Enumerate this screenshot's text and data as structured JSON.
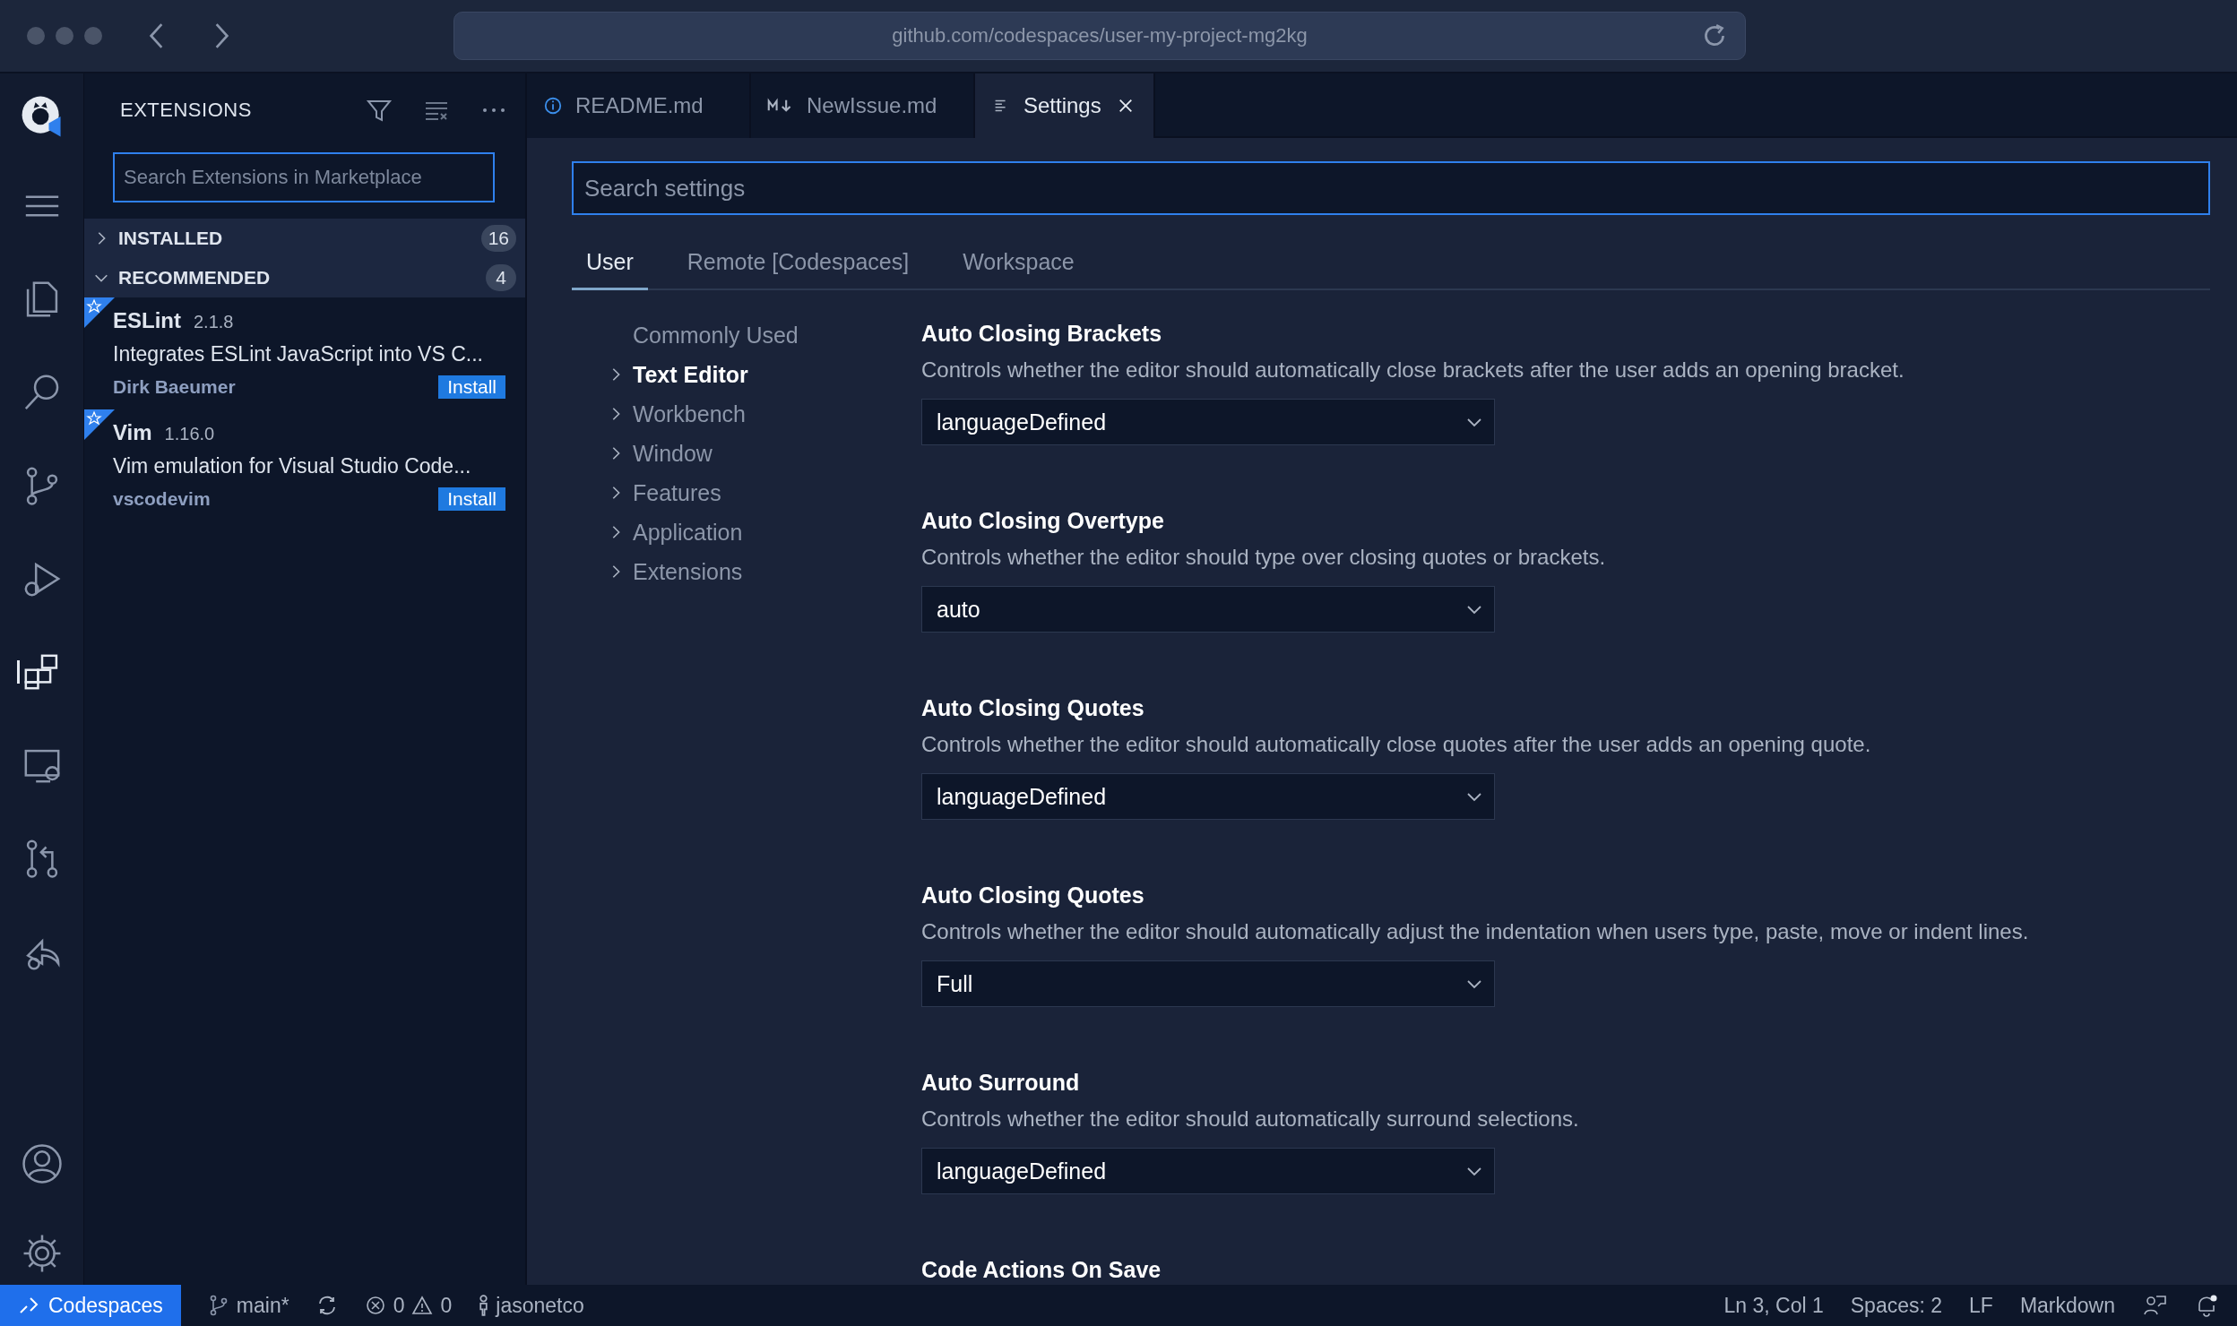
{
  "window": {
    "url": "github.com/codespaces/user-my-project-mg2kg"
  },
  "activity_bar": {
    "items": [
      {
        "selected": false
      },
      {
        "selected": false
      },
      {
        "selected": false
      },
      {
        "selected": false
      },
      {
        "selected": false
      },
      {
        "selected": true
      },
      {
        "selected": false
      },
      {
        "selected": false
      },
      {
        "selected": false
      }
    ]
  },
  "sidebar": {
    "title": "EXTENSIONS",
    "search": {
      "placeholder": "Search Extensions in Marketplace"
    },
    "sections": [
      {
        "label": "INSTALLED",
        "count": "16",
        "expanded": false
      },
      {
        "label": "RECOMMENDED",
        "count": "4",
        "expanded": true
      }
    ],
    "extensions": [
      {
        "name": "ESLint",
        "version": "2.1.8",
        "description": "Integrates ESLint JavaScript into VS C...",
        "publisher": "Dirk Baeumer",
        "button": "Install"
      },
      {
        "name": "Vim",
        "version": "1.16.0",
        "description": "Vim emulation for Visual Studio Code...",
        "publisher": "vscodevim",
        "button": "Install"
      }
    ]
  },
  "tabs": [
    {
      "label": "README.md",
      "selected": false
    },
    {
      "label": "NewIssue.md",
      "selected": false
    },
    {
      "label": "Settings",
      "selected": true
    }
  ],
  "settings": {
    "search": {
      "placeholder": "Search settings"
    },
    "scope_tabs": [
      {
        "label": "User",
        "selected": true
      },
      {
        "label": "Remote [Codespaces]",
        "selected": false
      },
      {
        "label": "Workspace",
        "selected": false
      }
    ],
    "nav": [
      {
        "label": "Commonly Used",
        "expandable": false,
        "selected": false
      },
      {
        "label": "Text Editor",
        "expandable": true,
        "selected": true
      },
      {
        "label": "Workbench",
        "expandable": true,
        "selected": false
      },
      {
        "label": "Window",
        "expandable": true,
        "selected": false
      },
      {
        "label": "Features",
        "expandable": true,
        "selected": false
      },
      {
        "label": "Application",
        "expandable": true,
        "selected": false
      },
      {
        "label": "Extensions",
        "expandable": true,
        "selected": false
      }
    ],
    "entries": [
      {
        "title": "Auto Closing Brackets",
        "description": "Controls whether the editor should automatically close brackets after the user adds an opening bracket.",
        "value": "languageDefined"
      },
      {
        "title": "Auto Closing Overtype",
        "description": "Controls whether the editor should type over closing quotes or brackets.",
        "value": "auto"
      },
      {
        "title": "Auto Closing Quotes",
        "description": "Controls whether the editor should automatically close quotes after the user adds an opening quote.",
        "value": "languageDefined"
      },
      {
        "title": "Auto Closing Quotes",
        "description": "Controls whether the editor should automatically adjust the indentation when users type, paste, move or indent lines.",
        "value": "Full"
      },
      {
        "title": "Auto Surround",
        "description": "Controls whether the editor should automatically surround selections.",
        "value": "languageDefined"
      },
      {
        "title": "Code Actions On Save"
      }
    ]
  },
  "status_bar": {
    "remote": "Codespaces",
    "branch": "main*",
    "errors": "0",
    "warnings": "0",
    "user": "jasonetco",
    "right": [
      "Ln 3, Col 1",
      "Spaces: 2",
      "LF",
      "Markdown"
    ]
  }
}
